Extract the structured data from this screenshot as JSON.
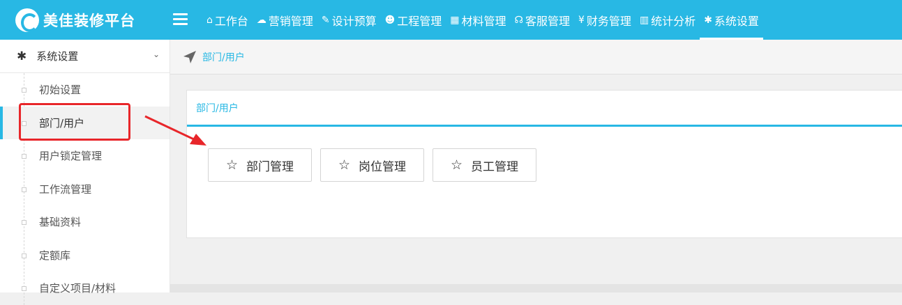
{
  "app": {
    "logo_text": "美佳装修平台"
  },
  "nav": {
    "items": [
      {
        "icon": "home-icon",
        "glyph": "⌂",
        "label": "工作台"
      },
      {
        "icon": "comments-icon",
        "glyph": "☁",
        "label": "营销管理"
      },
      {
        "icon": "edit-icon",
        "glyph": "✎",
        "label": "设计预算"
      },
      {
        "icon": "users-icon",
        "glyph": "☻",
        "label": "工程管理"
      },
      {
        "icon": "grid-icon",
        "glyph": "▦",
        "label": "材料管理"
      },
      {
        "icon": "headset-icon",
        "glyph": "☊",
        "label": "客服管理"
      },
      {
        "icon": "yen-icon",
        "glyph": "¥",
        "label": "财务管理"
      },
      {
        "icon": "bar-chart-icon",
        "glyph": "▥",
        "label": "统计分析"
      },
      {
        "icon": "gear-icon",
        "glyph": "✱",
        "label": "系统设置",
        "active": true
      }
    ]
  },
  "sidebar": {
    "header": {
      "label": "系统设置"
    },
    "items": [
      {
        "label": "初始设置"
      },
      {
        "label": "部门/用户",
        "active": true
      },
      {
        "label": "用户锁定管理"
      },
      {
        "label": "工作流管理"
      },
      {
        "label": "基础资料"
      },
      {
        "label": "定额库"
      },
      {
        "label": "自定义项目/材料"
      }
    ]
  },
  "breadcrumb": {
    "text": "部门/用户"
  },
  "panel": {
    "title": "部门/用户",
    "buttons": [
      {
        "label": "部门管理"
      },
      {
        "label": "岗位管理"
      },
      {
        "label": "员工管理"
      }
    ]
  },
  "colors": {
    "accent": "#28b8e4",
    "annotation": "#e8262a"
  }
}
